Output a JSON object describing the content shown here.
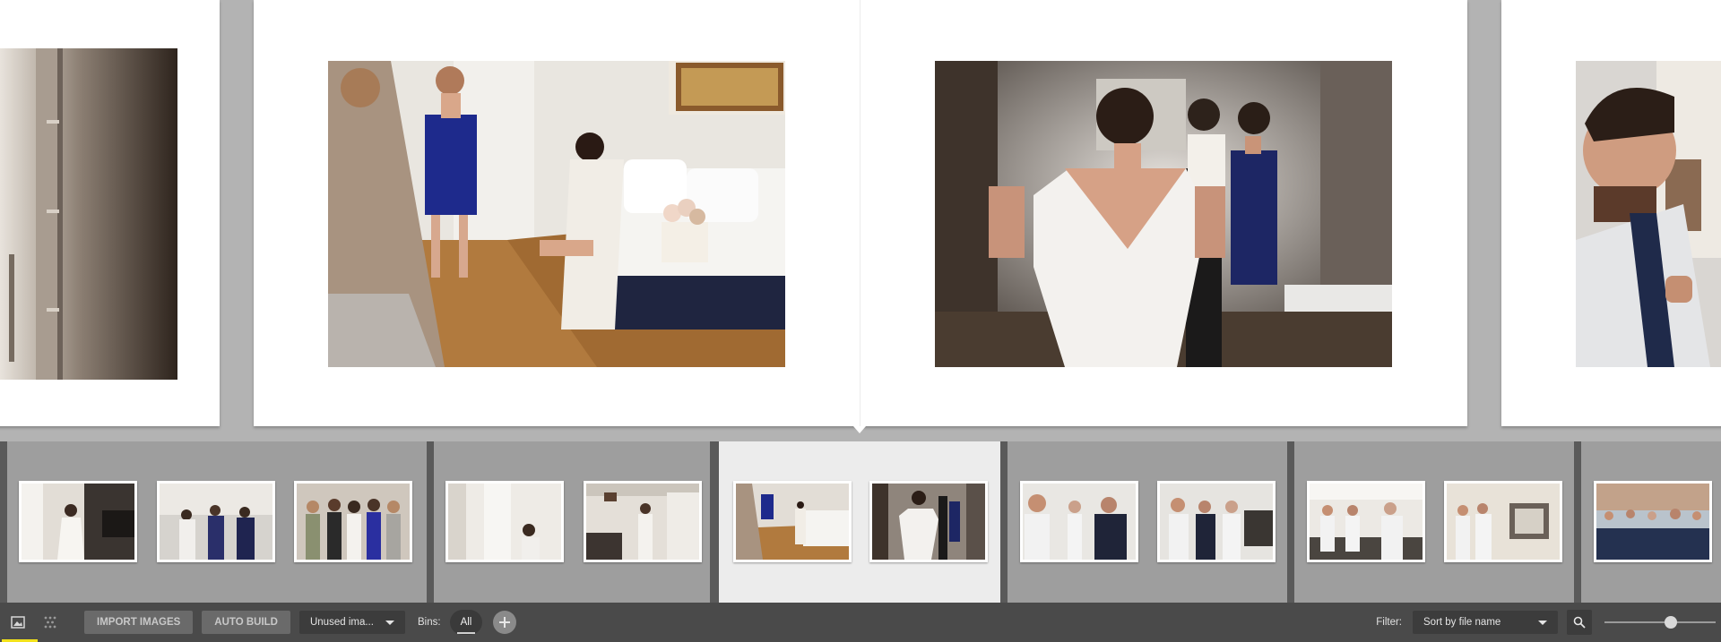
{
  "toolbar": {
    "import_label": "IMPORT IMAGES",
    "auto_build_label": "AUTO BUILD",
    "unused_select_value": "Unused ima...",
    "bins_label": "Bins:",
    "bin_all_label": "All",
    "filter_label": "Filter:",
    "sort_select_value": "Sort by file name",
    "zoom_level": 0.6
  },
  "icons": {
    "images_view": "image-icon",
    "layout_view": "grid-dots-icon",
    "add_bin": "plus-icon",
    "dropdown": "caret-down-icon",
    "search": "search-icon"
  },
  "colors": {
    "background": "#b3b3b3",
    "filmstrip_track": "#5a5a5a",
    "filmstrip_segment": "#9e9e9e",
    "current_spread": "#ececec",
    "toolbar": "#4a4a4a",
    "active_indicator": "#f3e21b"
  }
}
